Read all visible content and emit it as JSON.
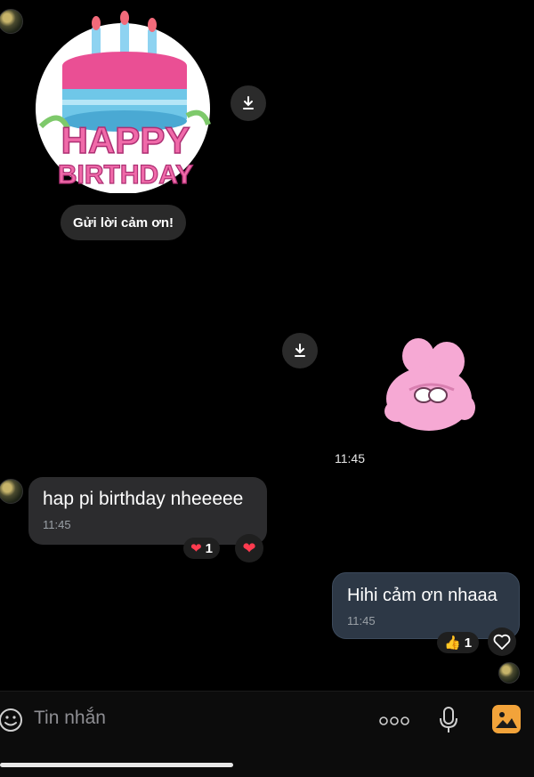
{
  "stickers": {
    "cake_text_1": "HAPPY",
    "cake_text_2": "BIRTHDAY"
  },
  "thank_you_button": "Gửi lời cảm ơn!",
  "time_center": "11:45",
  "messages": [
    {
      "text": "hap pi birthday nheeeee",
      "time": "11:45",
      "reaction_count": "1"
    },
    {
      "text": "Hihi cảm ơn nhaaa",
      "time": "11:45",
      "reaction_count": "1"
    }
  ],
  "composer": {
    "placeholder": "Tin nhắn"
  },
  "colors": {
    "incoming_bubble": "#2c2c2e",
    "outgoing_bubble": "#2d3846",
    "accent": "#f2a33a"
  }
}
